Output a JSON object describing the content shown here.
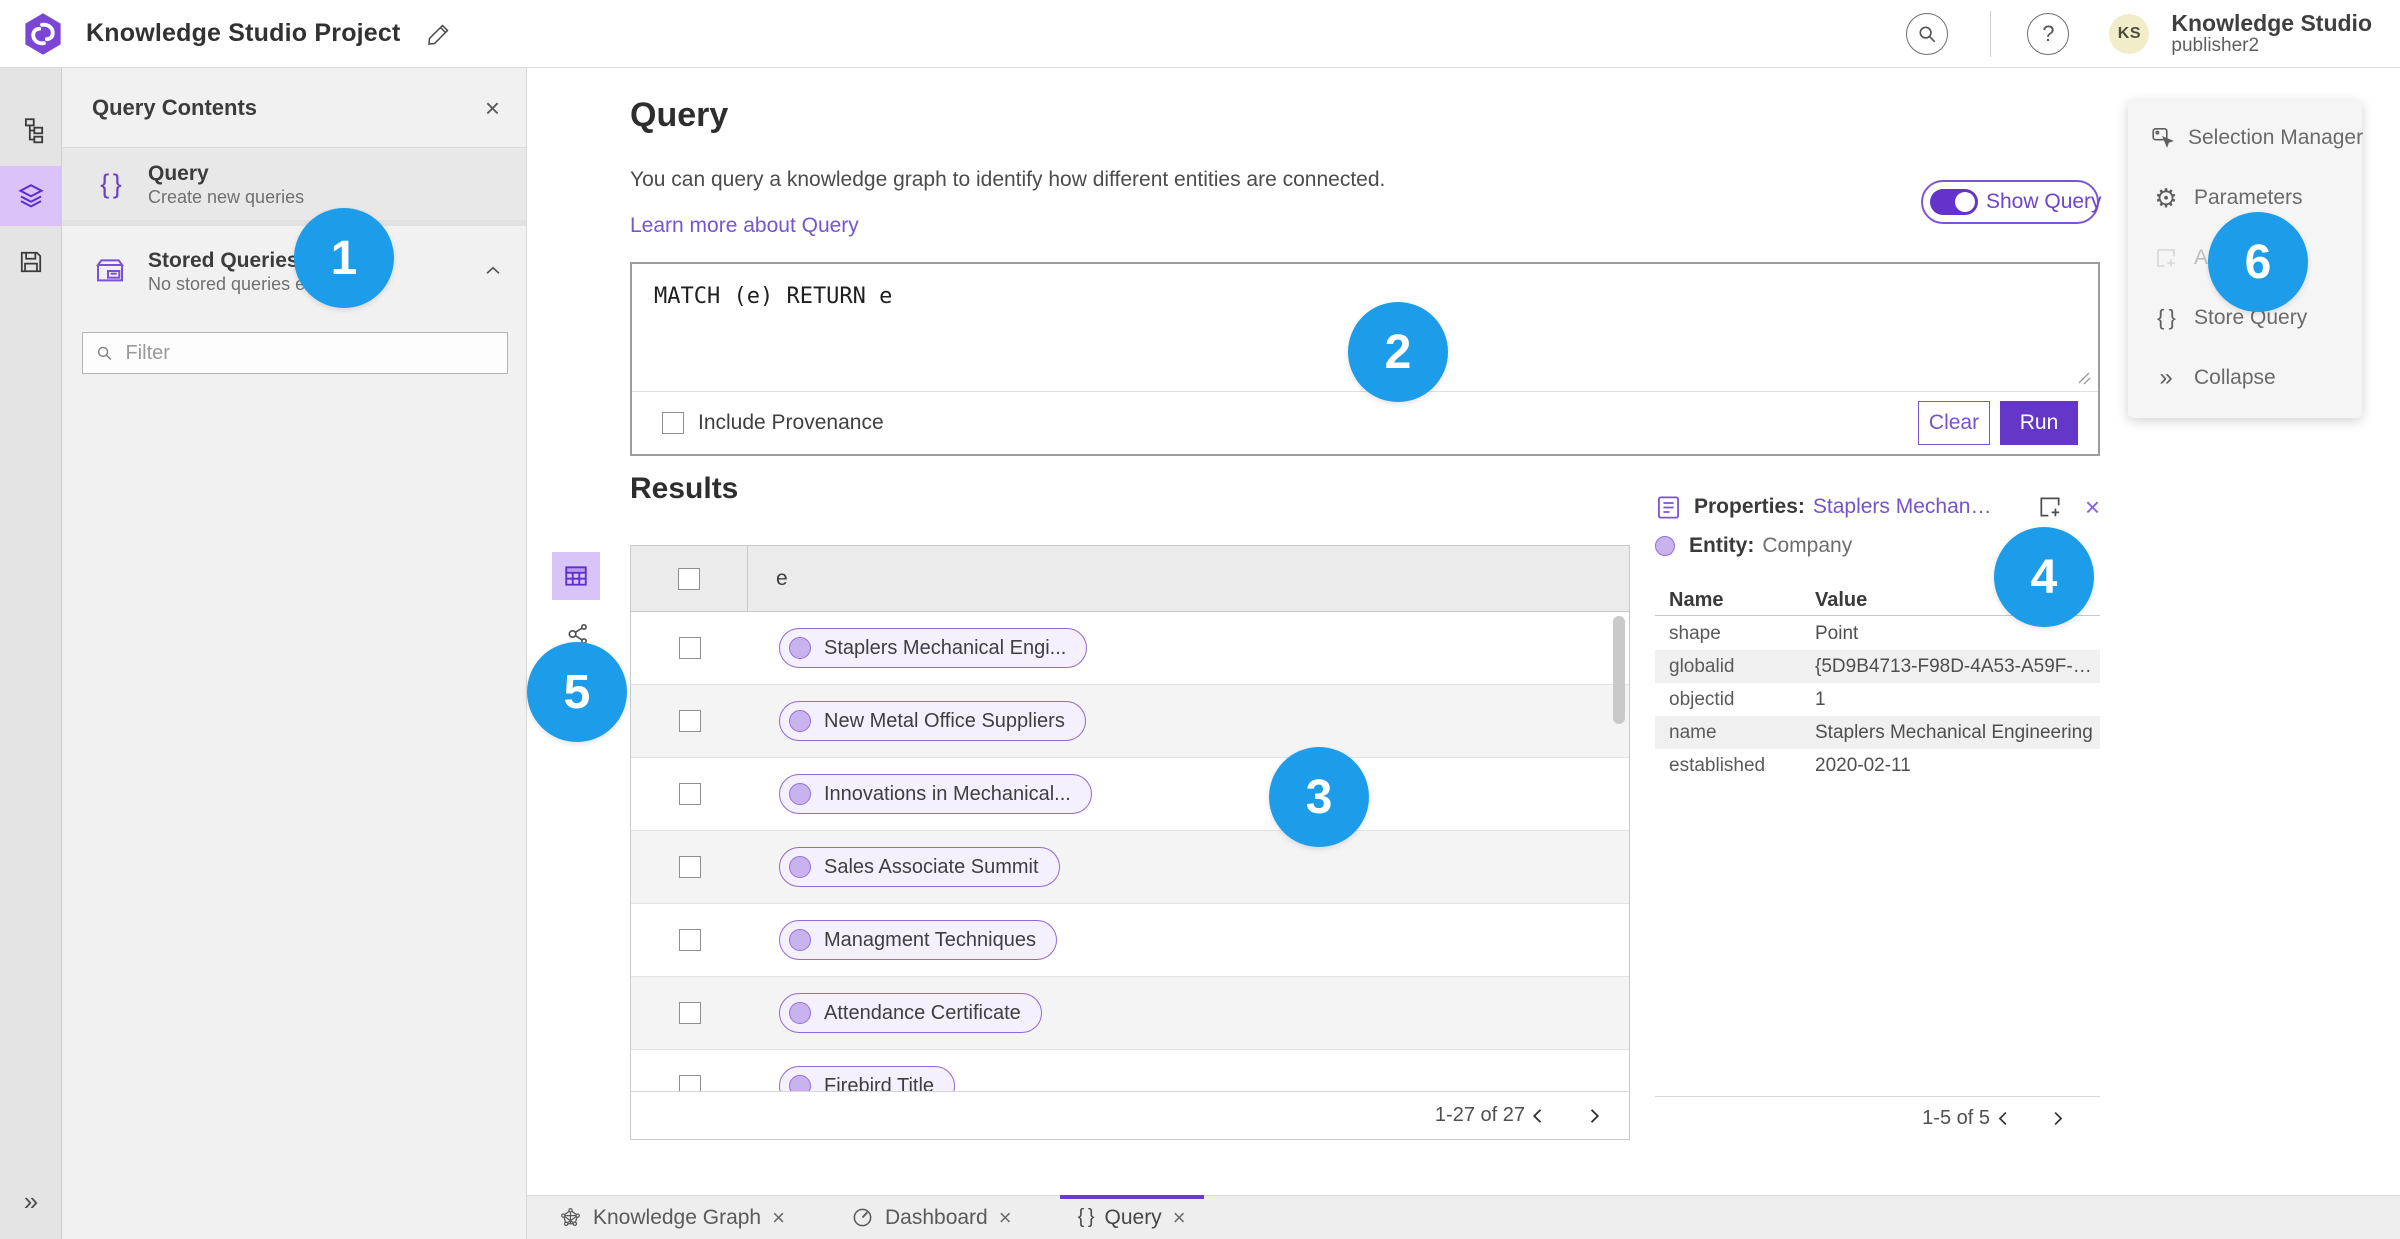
{
  "colors": {
    "accent_purple": "#6537c8",
    "link_purple": "#7456cf",
    "rail_active_bg": "#d9c3f8",
    "pill_fill": "#f4f0fd",
    "pill_border": "#8f6ad2",
    "badge_blue": "#1d9de9",
    "avatar_bg": "#f0edc8"
  },
  "icons": {
    "help": "?",
    "close": "×",
    "braces": "{ }",
    "expand": "»",
    "collapse": "»",
    "gear": "⚙"
  },
  "header": {
    "title": "Knowledge Studio Project",
    "avatar_initials": "KS",
    "user_name": "Knowledge Studio",
    "user_role": "publisher2"
  },
  "query_contents": {
    "title": "Query Contents",
    "query_item": {
      "label": "Query",
      "sublabel": "Create new queries"
    },
    "stored_item": {
      "label": "Stored Queries",
      "sublabel": "No stored queries exist"
    },
    "filter_placeholder": "Filter"
  },
  "query_panel": {
    "title": "Query",
    "description": "You can query a knowledge graph to identify how different entities are connected.",
    "link": "Learn more about Query",
    "show_query_label": "Show Query",
    "query_text": "MATCH (e) RETURN e",
    "include_provenance_label": "Include Provenance",
    "clear_label": "Clear",
    "run_label": "Run"
  },
  "results": {
    "title": "Results",
    "column": "e",
    "rows": [
      "Staplers Mechanical Engi...",
      "New Metal Office Suppliers",
      "Innovations in Mechanical...",
      "Sales Associate Summit",
      "Managment Techniques",
      "Attendance Certificate",
      "Firebird Title"
    ],
    "pagination": "1-27 of 27"
  },
  "properties": {
    "label": "Properties:",
    "link": "Staplers Mechanic...",
    "entity_label": "Entity:",
    "entity_value": "Company",
    "col_name": "Name",
    "col_value": "Value",
    "rows": [
      {
        "name": "shape",
        "value": "Point"
      },
      {
        "name": "globalid",
        "value": "{5D9B4713-F98D-4A53-A59F-C11..."
      },
      {
        "name": "objectid",
        "value": "1"
      },
      {
        "name": "name",
        "value": "Staplers Mechanical Engineering"
      },
      {
        "name": "established",
        "value": "2020-02-11"
      }
    ],
    "pagination": "1-5 of 5"
  },
  "side_menu": {
    "items": [
      {
        "label": "Selection Manager"
      },
      {
        "label": "Parameters"
      },
      {
        "label": "Add"
      },
      {
        "label": "Store Query"
      },
      {
        "label": "Collapse"
      }
    ]
  },
  "tabs": {
    "items": [
      {
        "label": "Knowledge Graph"
      },
      {
        "label": "Dashboard"
      },
      {
        "label": "Query"
      }
    ]
  },
  "callouts": [
    "1",
    "2",
    "3",
    "4",
    "5",
    "6"
  ]
}
